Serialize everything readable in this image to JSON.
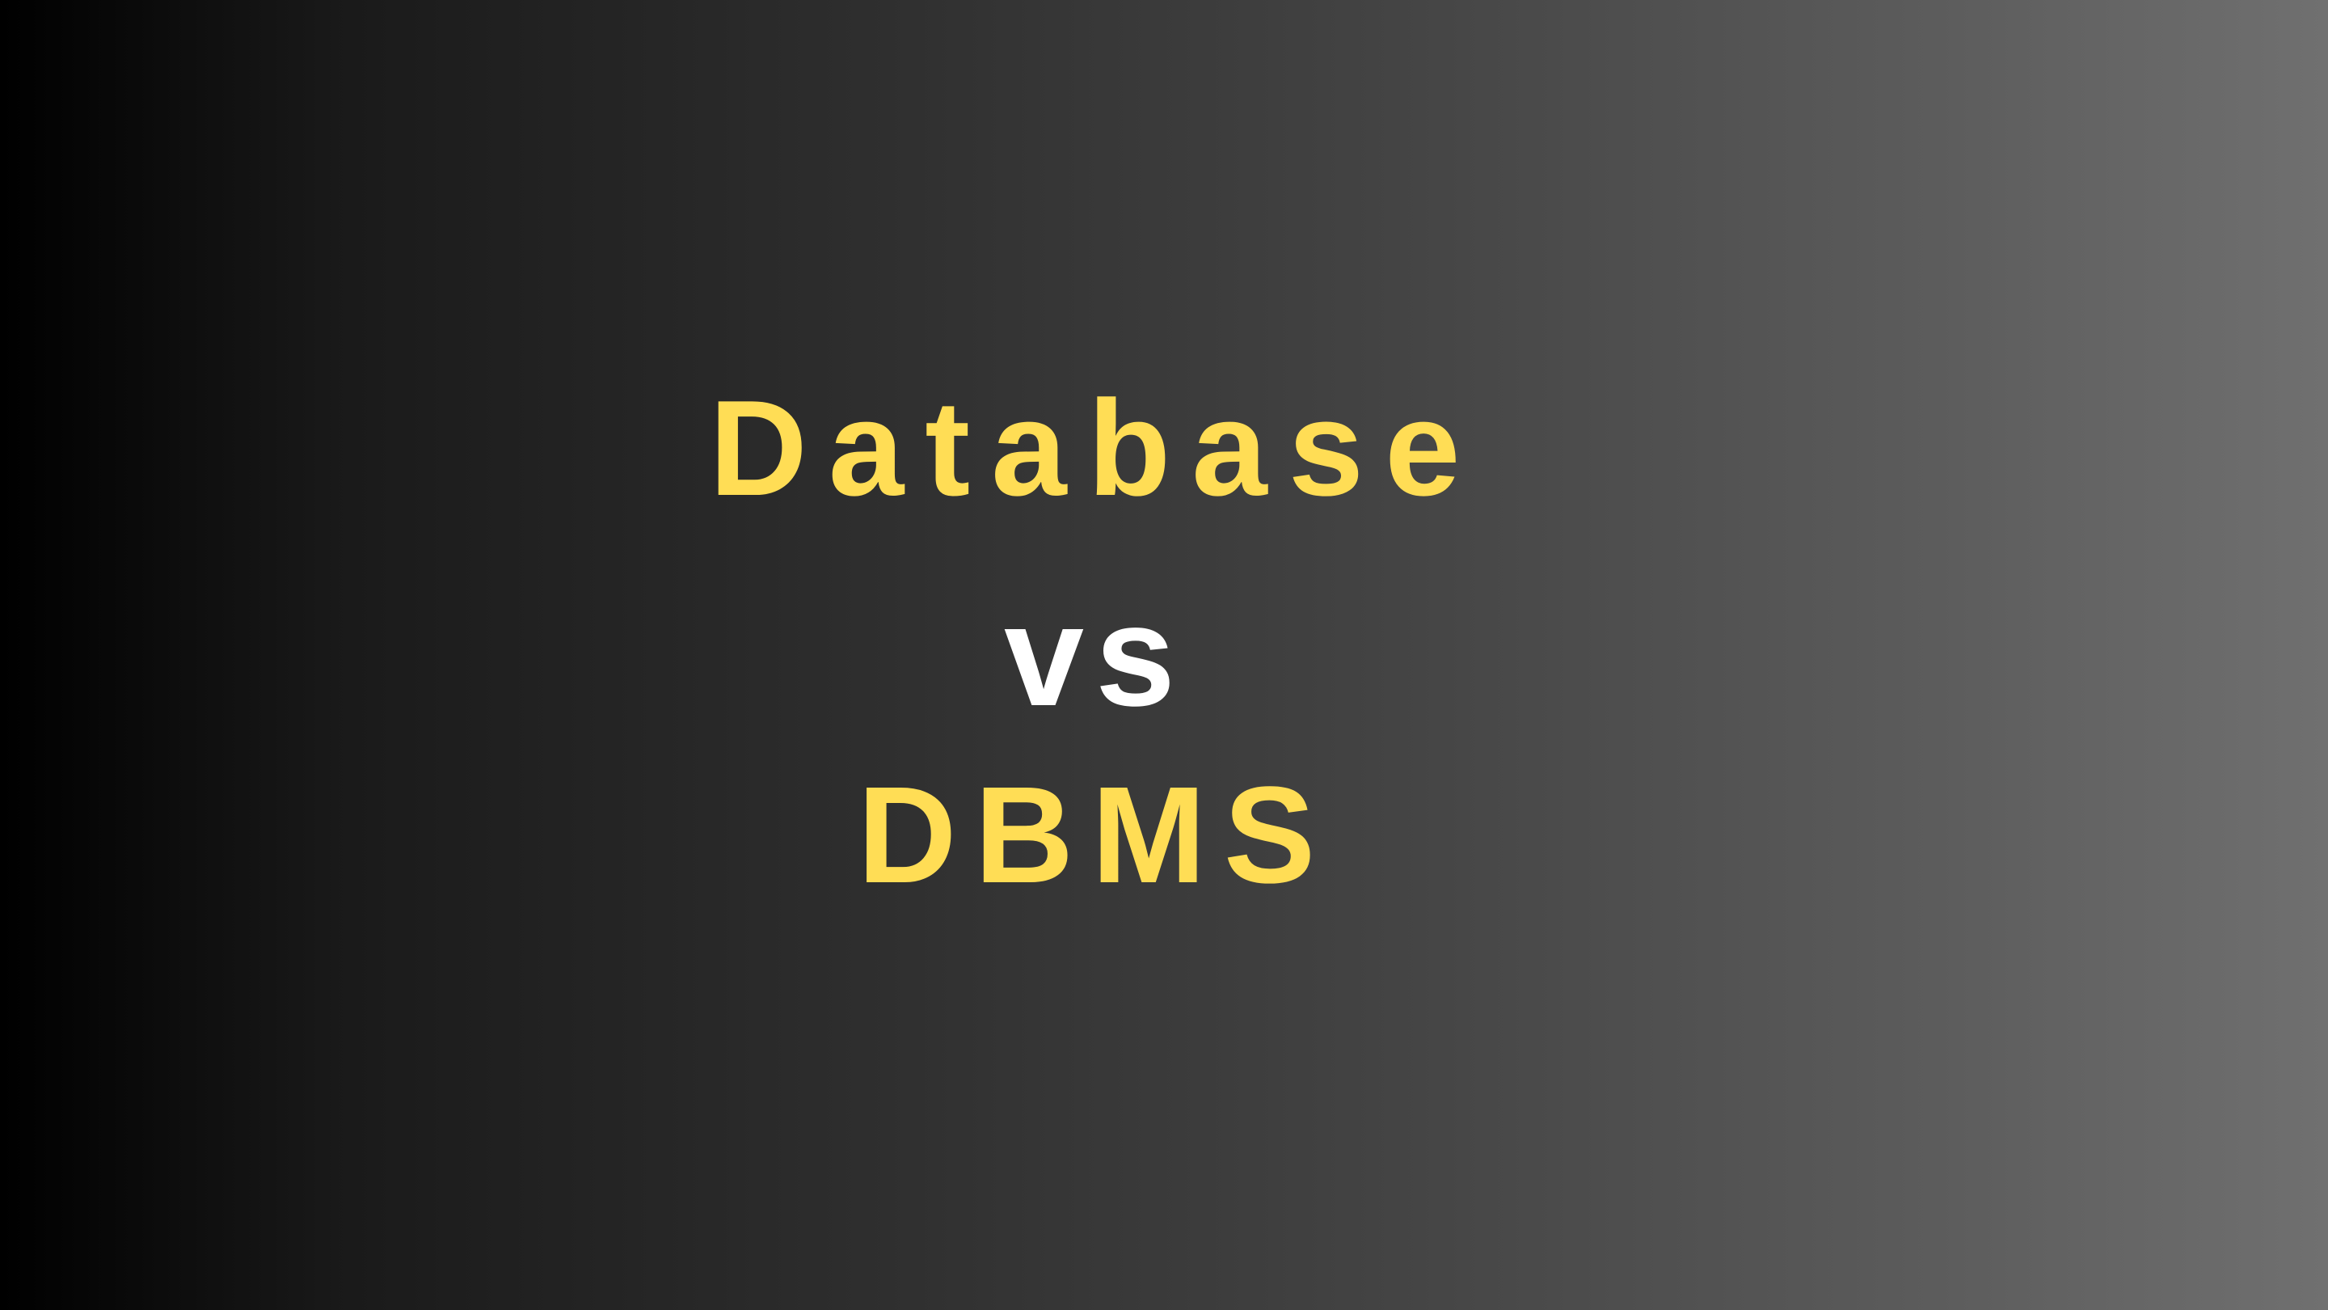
{
  "title": {
    "top": "Database",
    "middle": "vs",
    "bottom": "DBMS"
  },
  "colors": {
    "accent": "#FFDD55",
    "secondary": "#FFFFFF",
    "background_start": "#000000",
    "background_end": "#707070"
  }
}
